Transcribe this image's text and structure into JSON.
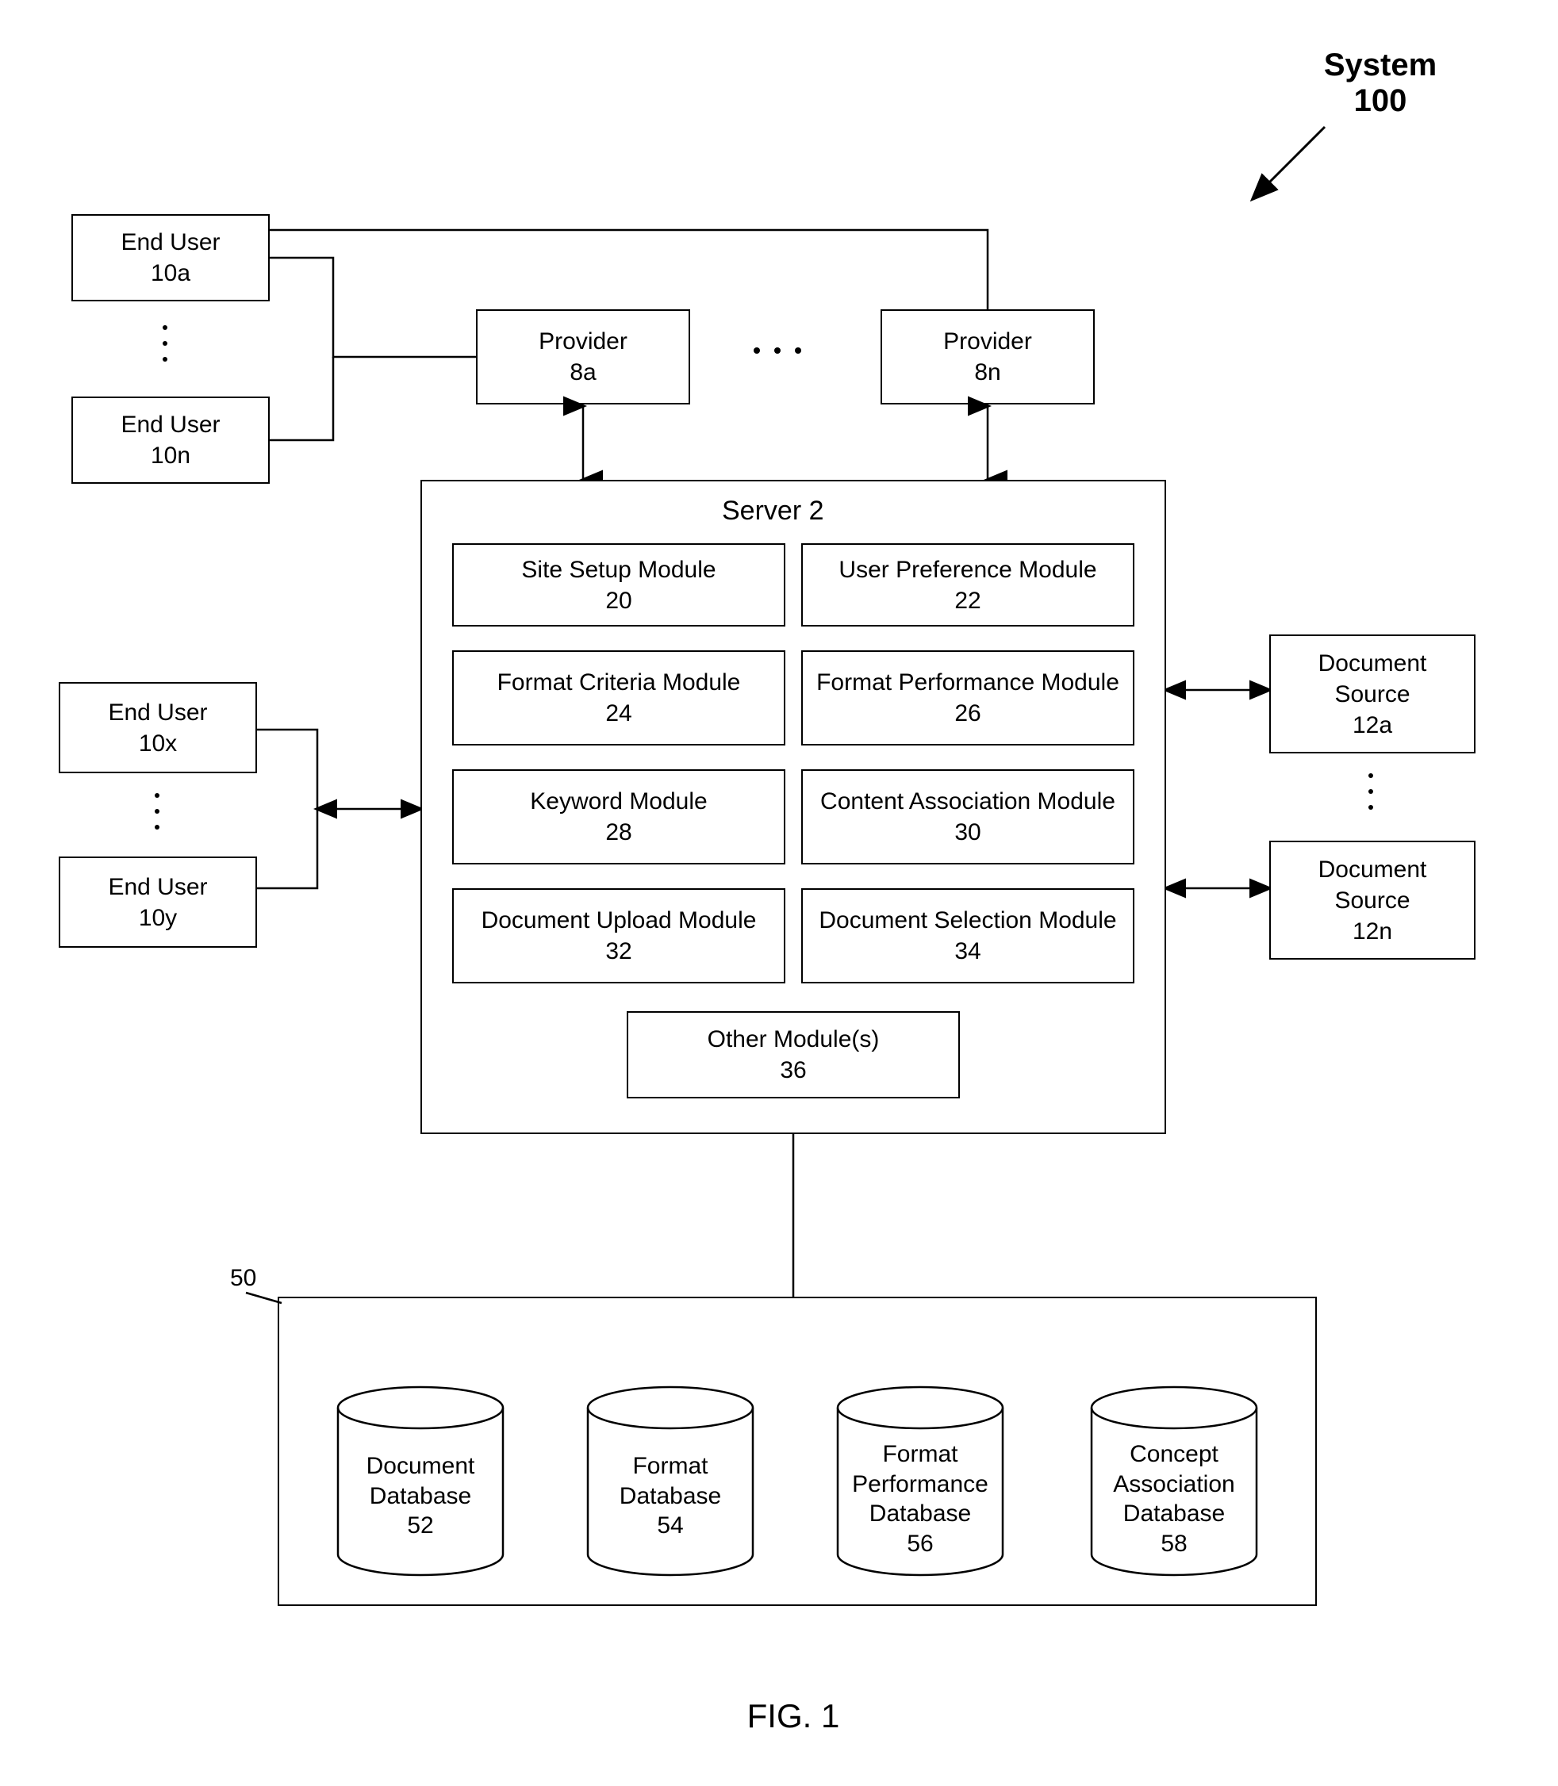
{
  "system": {
    "title": "System",
    "num": "100"
  },
  "figure": "FIG. 1",
  "endUsers": {
    "a": {
      "label": "End User",
      "num": "10a"
    },
    "n": {
      "label": "End User",
      "num": "10n"
    },
    "x": {
      "label": "End User",
      "num": "10x"
    },
    "y": {
      "label": "End User",
      "num": "10y"
    }
  },
  "providers": {
    "a": {
      "label": "Provider",
      "num": "8a"
    },
    "n": {
      "label": "Provider",
      "num": "8n"
    }
  },
  "server": {
    "title": "Server 2",
    "modules": {
      "siteSetup": {
        "label": "Site Setup Module",
        "num": "20"
      },
      "userPref": {
        "label": "User Preference Module",
        "num": "22"
      },
      "formatCrit": {
        "label": "Format Criteria Module",
        "num": "24"
      },
      "formatPerf": {
        "label": "Format Performance Module",
        "num": "26"
      },
      "keyword": {
        "label": "Keyword Module",
        "num": "28"
      },
      "contentAssoc": {
        "label": "Content Association Module",
        "num": "30"
      },
      "docUpload": {
        "label": "Document Upload Module",
        "num": "32"
      },
      "docSelect": {
        "label": "Document Selection Module",
        "num": "34"
      },
      "other": {
        "label": "Other Module(s)",
        "num": "36"
      }
    }
  },
  "docSources": {
    "a": {
      "label": "Document Source",
      "num": "12a"
    },
    "n": {
      "label": "Document Source",
      "num": "12n"
    }
  },
  "dbGroup": {
    "num": "50",
    "dbs": {
      "doc": {
        "label": "Document Database",
        "num": "52"
      },
      "format": {
        "label": "Format Database",
        "num": "54"
      },
      "formatPerf": {
        "label": "Format Performance Database",
        "num": "56"
      },
      "concept": {
        "label": "Concept Association Database",
        "num": "58"
      }
    }
  }
}
